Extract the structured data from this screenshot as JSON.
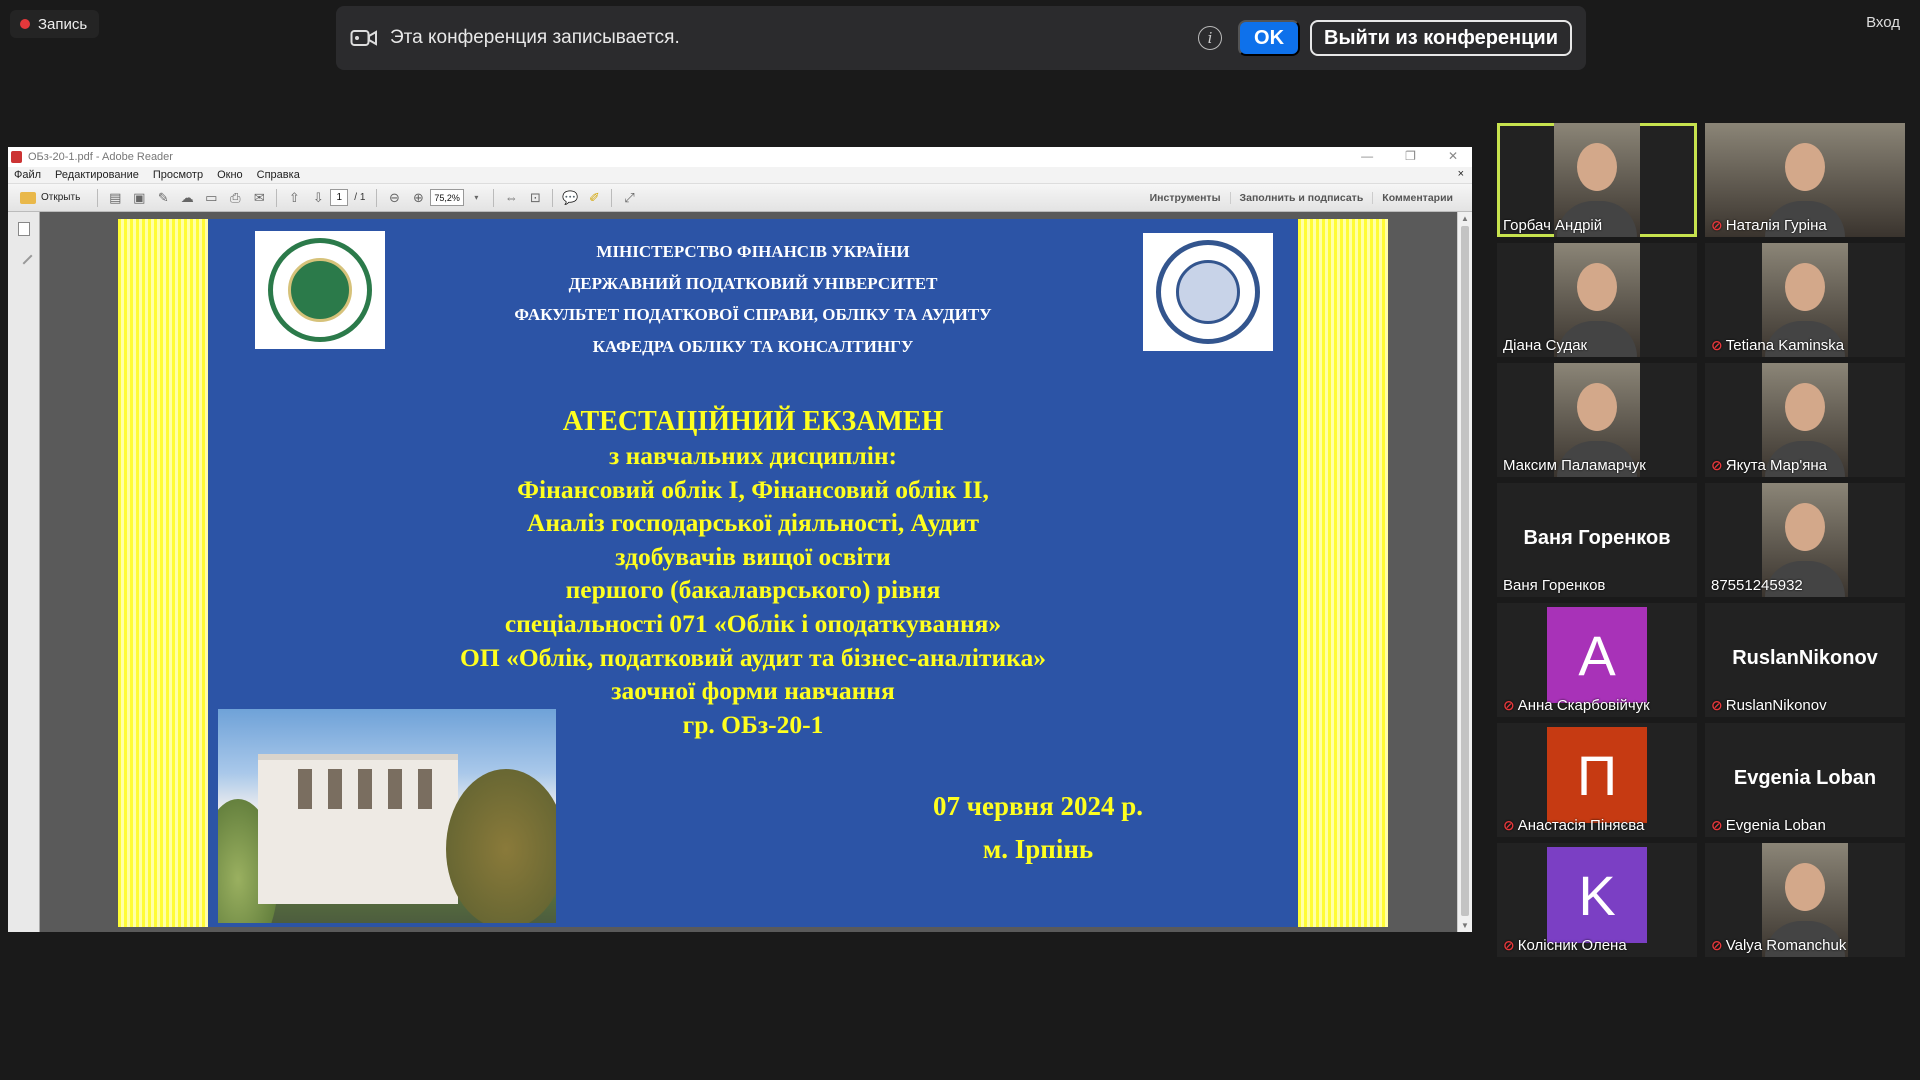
{
  "recording": {
    "label": "Запись"
  },
  "login": {
    "label": "Вход"
  },
  "banner": {
    "message": "Эта конференция записывается.",
    "ok_label": "OK",
    "leave_label": "Выйти из конференции"
  },
  "reader": {
    "title": "OБз-20-1.pdf - Adobe Reader",
    "menu": [
      "Файл",
      "Редактирование",
      "Просмотр",
      "Окно",
      "Справка"
    ],
    "open_label": "Открыть",
    "page_current": "1",
    "page_total": "/ 1",
    "zoom": "75,2%",
    "right_links": [
      "Инструменты",
      "Заполнить и подписать",
      "Комментарии"
    ]
  },
  "slide": {
    "header_lines": [
      "МІНІСТЕРСТВО ФІНАНСІВ УКРАЇНИ",
      "ДЕРЖАВНИЙ ПОДАТКОВИЙ УНІВЕРСИТЕТ",
      "ФАКУЛЬТЕТ ПОДАТКОВОЇ СПРАВИ, ОБЛІКУ ТА АУДИТУ",
      "КАФЕДРА ОБЛІКУ ТА КОНСАЛТИНГУ"
    ],
    "exam_title": "АТЕСТАЦІЙНИЙ ЕКЗАМЕН",
    "exam_lines": [
      "з навчальних дисциплін:",
      "Фінансовий облік І, Фінансовий облік ІІ,",
      "Аналіз господарської діяльності, Аудит",
      "здобувачів вищої освіти",
      "першого (бакалаврського) рівня",
      "спеціальності 071 «Облік і оподаткування»",
      "ОП «Облік, податковий аудит та бізнес-аналітика»",
      "заочної форми навчання",
      "гр. ОБз-20-1"
    ],
    "date": "07 червня 2024 р.",
    "city": "м. Ірпінь"
  },
  "participants": [
    {
      "name": "Горбач Андрій",
      "muted": false,
      "kind": "video",
      "active": true
    },
    {
      "name": "Наталія Гуріна",
      "muted": true,
      "kind": "video"
    },
    {
      "name": "Діана Судак",
      "muted": false,
      "kind": "video"
    },
    {
      "name": "Tetiana Kaminska",
      "muted": true,
      "kind": "video"
    },
    {
      "name": "Максим Паламарчук",
      "muted": false,
      "kind": "video"
    },
    {
      "name": "Якута Мар'яна",
      "muted": true,
      "kind": "video"
    },
    {
      "name": "Ваня Горенков",
      "muted": false,
      "kind": "name",
      "display": "Ваня Горенков"
    },
    {
      "name": "87551245932",
      "muted": false,
      "kind": "video"
    },
    {
      "name": "Анна Скарбовійчук",
      "muted": true,
      "kind": "avatar",
      "letter": "A",
      "color": "#a832b8"
    },
    {
      "name": "RuslanNikonov",
      "muted": true,
      "kind": "name",
      "display": "RuslanNikonov"
    },
    {
      "name": "Анастасія Пiняєва",
      "muted": true,
      "kind": "avatar",
      "letter": "П",
      "color": "#c63a12"
    },
    {
      "name": "Evgenia Loban",
      "muted": true,
      "kind": "name",
      "display": "Evgenia Loban"
    },
    {
      "name": "Колісник Олена",
      "muted": true,
      "kind": "avatar",
      "letter": "K",
      "color": "#7b3fc4"
    },
    {
      "name": "Valya Romanchuk",
      "muted": true,
      "kind": "video"
    }
  ],
  "colors": {
    "accent_blue": "#0e71eb",
    "active_speaker": "#c7e34e",
    "slide_bg": "#2c54a6",
    "slide_text_yellow": "#ffff1f",
    "mic_muted": "#e5383b"
  }
}
